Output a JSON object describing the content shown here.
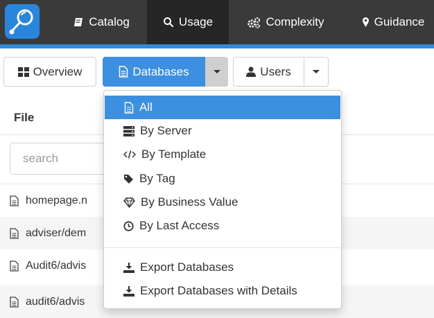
{
  "nav": {
    "logo_icon": "search-magnifier-logo",
    "items": [
      {
        "label": "Catalog",
        "icon": "book-icon",
        "active": false
      },
      {
        "label": "Usage",
        "icon": "search-icon",
        "active": true
      },
      {
        "label": "Complexity",
        "icon": "cogs-icon",
        "active": false
      },
      {
        "label": "Guidance",
        "icon": "map-marker-icon",
        "active": false
      }
    ],
    "accent_color": "#2f8ce0",
    "bar_color": "#3a3a3a"
  },
  "toolbar": {
    "overview_label": "Overview",
    "databases_label": "Databases",
    "users_label": "Users",
    "primary_color": "#3d8fe0"
  },
  "table": {
    "header": "File",
    "search_placeholder": "search",
    "rows": [
      "homepage.n",
      "adviser/dem",
      "Audit6/advis",
      "audit6/advis"
    ]
  },
  "dropdown": {
    "items": [
      {
        "label": "All",
        "icon": "file-icon",
        "active": true
      },
      {
        "label": "By Server",
        "icon": "server-icon",
        "active": false
      },
      {
        "label": "By Template",
        "icon": "code-icon",
        "active": false
      },
      {
        "label": "By Tag",
        "icon": "tag-icon",
        "active": false
      },
      {
        "label": "By Business Value",
        "icon": "diamond-icon",
        "active": false
      },
      {
        "label": "By Last Access",
        "icon": "clock-icon",
        "active": false
      }
    ],
    "export_items": [
      {
        "label": "Export Databases",
        "icon": "download-icon"
      },
      {
        "label": "Export Databases with Details",
        "icon": "download-icon"
      }
    ]
  }
}
